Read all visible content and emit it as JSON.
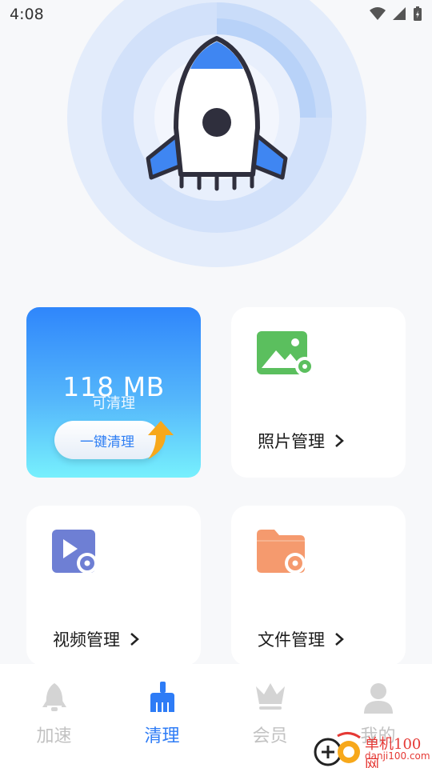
{
  "status_bar": {
    "time": "4:08"
  },
  "hero": {
    "icon": "rocket-icon"
  },
  "clean_card": {
    "size": "118 MB",
    "label": "可清理",
    "button_label": "一键清理"
  },
  "cards": {
    "photo": {
      "title": "照片管理",
      "icon": "photo-settings-icon"
    },
    "video": {
      "title": "视频管理",
      "icon": "video-settings-icon"
    },
    "file": {
      "title": "文件管理",
      "icon": "folder-settings-icon"
    }
  },
  "tabs": [
    {
      "label": "加速",
      "icon": "rocket-tab-icon"
    },
    {
      "label": "清理",
      "icon": "broom-icon",
      "active": true
    },
    {
      "label": "会员",
      "icon": "crown-icon"
    },
    {
      "label": "我的",
      "icon": "user-icon"
    }
  ],
  "watermark": {
    "line1": "单机100网",
    "line2": "danji100.com"
  },
  "colors": {
    "accent": "#2e7cf6",
    "photo": "#5bbf5e",
    "video": "#6e7fd4",
    "file": "#f59a6e"
  }
}
